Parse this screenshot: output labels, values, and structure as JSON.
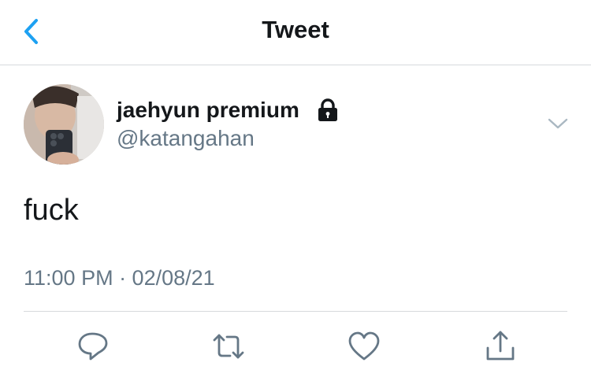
{
  "navbar": {
    "title": "Tweet",
    "back_icon": "chevron-left-icon"
  },
  "tweet": {
    "author": {
      "display_name": "jaehyun premium",
      "handle": "@katangahan",
      "protected_icon": "lock-icon"
    },
    "text": "fuck",
    "timestamp": "11:00 PM · 02/08/21"
  },
  "actions": [
    {
      "name": "reply",
      "icon": "comment-icon"
    },
    {
      "name": "retweet",
      "icon": "retweet-icon"
    },
    {
      "name": "like",
      "icon": "heart-icon"
    },
    {
      "name": "share",
      "icon": "share-icon"
    }
  ],
  "colors": {
    "accent": "#1da1f2",
    "text_primary": "#14171a",
    "text_secondary": "#657786",
    "divider": "#d6d9dc"
  }
}
